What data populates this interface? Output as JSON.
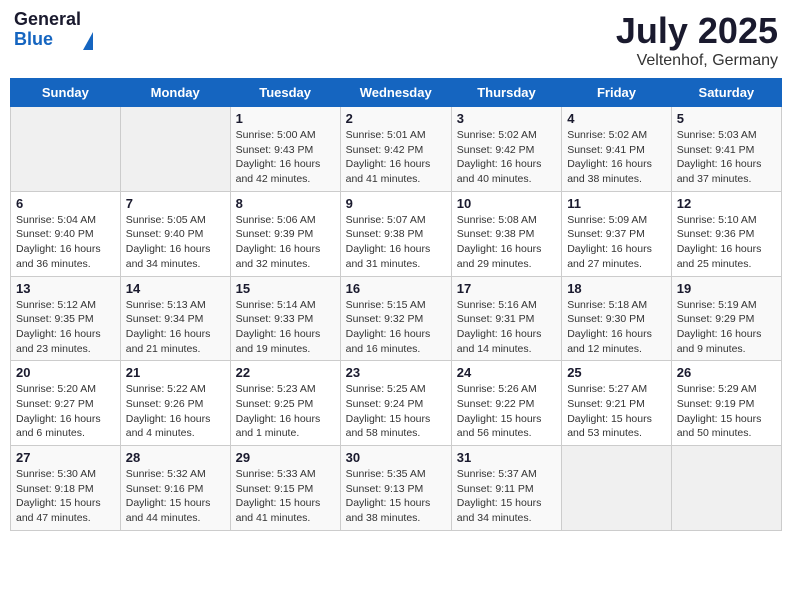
{
  "header": {
    "logo_general": "General",
    "logo_blue": "Blue",
    "month": "July 2025",
    "location": "Veltenhof, Germany"
  },
  "weekdays": [
    "Sunday",
    "Monday",
    "Tuesday",
    "Wednesday",
    "Thursday",
    "Friday",
    "Saturday"
  ],
  "weeks": [
    [
      {
        "day": "",
        "info": ""
      },
      {
        "day": "",
        "info": ""
      },
      {
        "day": "1",
        "info": "Sunrise: 5:00 AM\nSunset: 9:43 PM\nDaylight: 16 hours and 42 minutes."
      },
      {
        "day": "2",
        "info": "Sunrise: 5:01 AM\nSunset: 9:42 PM\nDaylight: 16 hours and 41 minutes."
      },
      {
        "day": "3",
        "info": "Sunrise: 5:02 AM\nSunset: 9:42 PM\nDaylight: 16 hours and 40 minutes."
      },
      {
        "day": "4",
        "info": "Sunrise: 5:02 AM\nSunset: 9:41 PM\nDaylight: 16 hours and 38 minutes."
      },
      {
        "day": "5",
        "info": "Sunrise: 5:03 AM\nSunset: 9:41 PM\nDaylight: 16 hours and 37 minutes."
      }
    ],
    [
      {
        "day": "6",
        "info": "Sunrise: 5:04 AM\nSunset: 9:40 PM\nDaylight: 16 hours and 36 minutes."
      },
      {
        "day": "7",
        "info": "Sunrise: 5:05 AM\nSunset: 9:40 PM\nDaylight: 16 hours and 34 minutes."
      },
      {
        "day": "8",
        "info": "Sunrise: 5:06 AM\nSunset: 9:39 PM\nDaylight: 16 hours and 32 minutes."
      },
      {
        "day": "9",
        "info": "Sunrise: 5:07 AM\nSunset: 9:38 PM\nDaylight: 16 hours and 31 minutes."
      },
      {
        "day": "10",
        "info": "Sunrise: 5:08 AM\nSunset: 9:38 PM\nDaylight: 16 hours and 29 minutes."
      },
      {
        "day": "11",
        "info": "Sunrise: 5:09 AM\nSunset: 9:37 PM\nDaylight: 16 hours and 27 minutes."
      },
      {
        "day": "12",
        "info": "Sunrise: 5:10 AM\nSunset: 9:36 PM\nDaylight: 16 hours and 25 minutes."
      }
    ],
    [
      {
        "day": "13",
        "info": "Sunrise: 5:12 AM\nSunset: 9:35 PM\nDaylight: 16 hours and 23 minutes."
      },
      {
        "day": "14",
        "info": "Sunrise: 5:13 AM\nSunset: 9:34 PM\nDaylight: 16 hours and 21 minutes."
      },
      {
        "day": "15",
        "info": "Sunrise: 5:14 AM\nSunset: 9:33 PM\nDaylight: 16 hours and 19 minutes."
      },
      {
        "day": "16",
        "info": "Sunrise: 5:15 AM\nSunset: 9:32 PM\nDaylight: 16 hours and 16 minutes."
      },
      {
        "day": "17",
        "info": "Sunrise: 5:16 AM\nSunset: 9:31 PM\nDaylight: 16 hours and 14 minutes."
      },
      {
        "day": "18",
        "info": "Sunrise: 5:18 AM\nSunset: 9:30 PM\nDaylight: 16 hours and 12 minutes."
      },
      {
        "day": "19",
        "info": "Sunrise: 5:19 AM\nSunset: 9:29 PM\nDaylight: 16 hours and 9 minutes."
      }
    ],
    [
      {
        "day": "20",
        "info": "Sunrise: 5:20 AM\nSunset: 9:27 PM\nDaylight: 16 hours and 6 minutes."
      },
      {
        "day": "21",
        "info": "Sunrise: 5:22 AM\nSunset: 9:26 PM\nDaylight: 16 hours and 4 minutes."
      },
      {
        "day": "22",
        "info": "Sunrise: 5:23 AM\nSunset: 9:25 PM\nDaylight: 16 hours and 1 minute."
      },
      {
        "day": "23",
        "info": "Sunrise: 5:25 AM\nSunset: 9:24 PM\nDaylight: 15 hours and 58 minutes."
      },
      {
        "day": "24",
        "info": "Sunrise: 5:26 AM\nSunset: 9:22 PM\nDaylight: 15 hours and 56 minutes."
      },
      {
        "day": "25",
        "info": "Sunrise: 5:27 AM\nSunset: 9:21 PM\nDaylight: 15 hours and 53 minutes."
      },
      {
        "day": "26",
        "info": "Sunrise: 5:29 AM\nSunset: 9:19 PM\nDaylight: 15 hours and 50 minutes."
      }
    ],
    [
      {
        "day": "27",
        "info": "Sunrise: 5:30 AM\nSunset: 9:18 PM\nDaylight: 15 hours and 47 minutes."
      },
      {
        "day": "28",
        "info": "Sunrise: 5:32 AM\nSunset: 9:16 PM\nDaylight: 15 hours and 44 minutes."
      },
      {
        "day": "29",
        "info": "Sunrise: 5:33 AM\nSunset: 9:15 PM\nDaylight: 15 hours and 41 minutes."
      },
      {
        "day": "30",
        "info": "Sunrise: 5:35 AM\nSunset: 9:13 PM\nDaylight: 15 hours and 38 minutes."
      },
      {
        "day": "31",
        "info": "Sunrise: 5:37 AM\nSunset: 9:11 PM\nDaylight: 15 hours and 34 minutes."
      },
      {
        "day": "",
        "info": ""
      },
      {
        "day": "",
        "info": ""
      }
    ]
  ]
}
